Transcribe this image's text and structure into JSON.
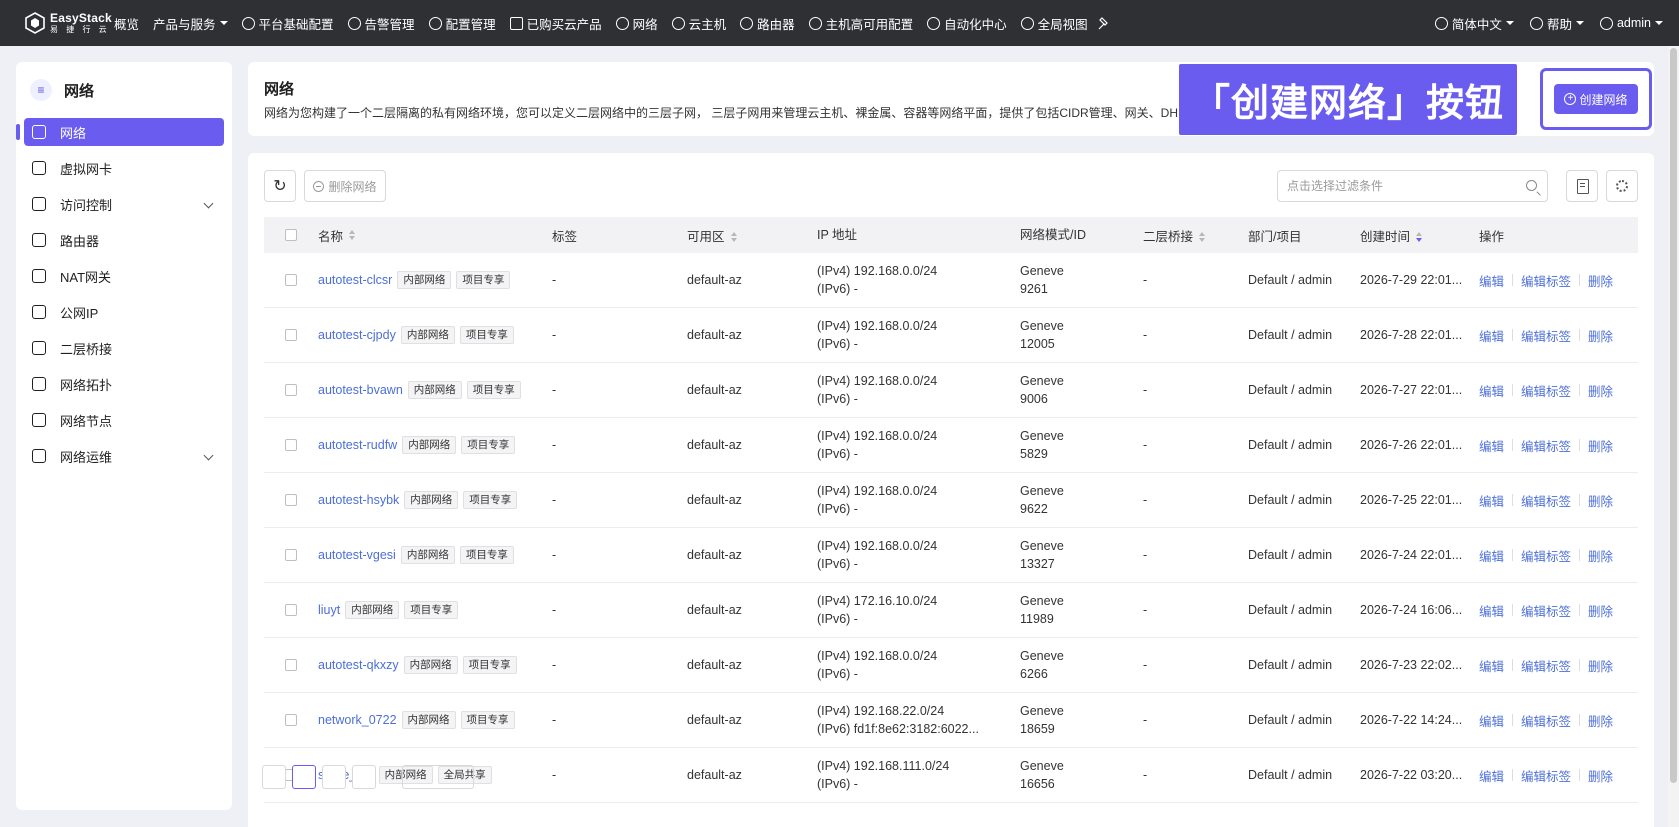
{
  "brand": {
    "name_en": "EasyStack",
    "name_cn": "易 捷 行 云"
  },
  "topnav": {
    "items": [
      {
        "label": "概览",
        "icon": "",
        "caret": false
      },
      {
        "label": "产品与服务",
        "icon": "",
        "caret": true
      },
      {
        "label": "平台基础配置",
        "icon": "gear-icon",
        "caret": false
      },
      {
        "label": "告警管理",
        "icon": "bell-icon",
        "caret": false
      },
      {
        "label": "配置管理",
        "icon": "settings-icon",
        "caret": false
      },
      {
        "label": "已购买云产品",
        "icon": "list-icon",
        "caret": false
      },
      {
        "label": "网络",
        "icon": "network-icon",
        "caret": false
      },
      {
        "label": "云主机",
        "icon": "cloud-icon",
        "caret": false
      },
      {
        "label": "路由器",
        "icon": "router-icon",
        "caret": false
      },
      {
        "label": "主机高可用配置",
        "icon": "host-ha-icon",
        "caret": false
      },
      {
        "label": "自动化中心",
        "icon": "automation-icon",
        "caret": false
      },
      {
        "label": "全局视图",
        "icon": "global-view-icon",
        "caret": false
      }
    ],
    "right": {
      "language": "简体中文",
      "help": "帮助",
      "user": "admin"
    }
  },
  "sidebar": {
    "title": "网络",
    "items": [
      {
        "label": "网络",
        "icon": "network-icon",
        "active": true,
        "expandable": false
      },
      {
        "label": "虚拟网卡",
        "icon": "nic-icon",
        "active": false,
        "expandable": false
      },
      {
        "label": "访问控制",
        "icon": "access-control-icon",
        "active": false,
        "expandable": true
      },
      {
        "label": "路由器",
        "icon": "router-icon",
        "active": false,
        "expandable": false
      },
      {
        "label": "NAT网关",
        "icon": "nat-gateway-icon",
        "active": false,
        "expandable": false
      },
      {
        "label": "公网IP",
        "icon": "public-ip-icon",
        "active": false,
        "expandable": false
      },
      {
        "label": "二层桥接",
        "icon": "bridge-icon",
        "active": false,
        "expandable": false
      },
      {
        "label": "网络拓扑",
        "icon": "topology-icon",
        "active": false,
        "expandable": false
      },
      {
        "label": "网络节点",
        "icon": "node-icon",
        "active": false,
        "expandable": false
      },
      {
        "label": "网络运维",
        "icon": "ops-icon",
        "active": false,
        "expandable": true
      }
    ]
  },
  "header": {
    "title": "网络",
    "description": "网络为您构建了一个二层隔离的私有网络环境，您可以定义二层网络中的三层子网， 三层子网用来管理云主机、裸金属、容器等网络平面，提供了包括CIDR管理、网关、DH",
    "create_button": "创建网络",
    "annotation": "「创建网络」按钮"
  },
  "toolbar": {
    "delete_label": "删除网络",
    "search_placeholder": "点击选择过滤条件"
  },
  "table": {
    "columns": [
      "名称",
      "标签",
      "可用区",
      "IP 地址",
      "网络模式/ID",
      "二层桥接",
      "部门/项目",
      "创建时间",
      "操作"
    ],
    "ops": [
      "编辑",
      "编辑标签",
      "删除"
    ],
    "rows": [
      {
        "name": "autotest-clcsr",
        "badges": [
          "内部网络",
          "项目专享"
        ],
        "tag": "-",
        "az": "default-az",
        "ipv4": "(IPv4) 192.168.0.0/24",
        "ipv6": "(IPv6) -",
        "mode": "Geneve",
        "id": "9261",
        "bridge": "-",
        "dept": "Default / admin",
        "time": "2026-7-29 22:01..."
      },
      {
        "name": "autotest-cjpdy",
        "badges": [
          "内部网络",
          "项目专享"
        ],
        "tag": "-",
        "az": "default-az",
        "ipv4": "(IPv4) 192.168.0.0/24",
        "ipv6": "(IPv6) -",
        "mode": "Geneve",
        "id": "12005",
        "bridge": "-",
        "dept": "Default / admin",
        "time": "2026-7-28 22:01..."
      },
      {
        "name": "autotest-bvawn",
        "badges": [
          "内部网络",
          "项目专享"
        ],
        "tag": "-",
        "az": "default-az",
        "ipv4": "(IPv4) 192.168.0.0/24",
        "ipv6": "(IPv6) -",
        "mode": "Geneve",
        "id": "9006",
        "bridge": "-",
        "dept": "Default / admin",
        "time": "2026-7-27 22:01..."
      },
      {
        "name": "autotest-rudfw",
        "badges": [
          "内部网络",
          "项目专享"
        ],
        "tag": "-",
        "az": "default-az",
        "ipv4": "(IPv4) 192.168.0.0/24",
        "ipv6": "(IPv6) -",
        "mode": "Geneve",
        "id": "5829",
        "bridge": "-",
        "dept": "Default / admin",
        "time": "2026-7-26 22:01..."
      },
      {
        "name": "autotest-hsybk",
        "badges": [
          "内部网络",
          "项目专享"
        ],
        "tag": "-",
        "az": "default-az",
        "ipv4": "(IPv4) 192.168.0.0/24",
        "ipv6": "(IPv6) -",
        "mode": "Geneve",
        "id": "9622",
        "bridge": "-",
        "dept": "Default / admin",
        "time": "2026-7-25 22:01..."
      },
      {
        "name": "autotest-vgesi",
        "badges": [
          "内部网络",
          "项目专享"
        ],
        "tag": "-",
        "az": "default-az",
        "ipv4": "(IPv4) 192.168.0.0/24",
        "ipv6": "(IPv6) -",
        "mode": "Geneve",
        "id": "13327",
        "bridge": "-",
        "dept": "Default / admin",
        "time": "2026-7-24 22:01..."
      },
      {
        "name": "liuyt",
        "badges": [
          "内部网络",
          "项目专享"
        ],
        "tag": "-",
        "az": "default-az",
        "ipv4": "(IPv4) 172.16.10.0/24",
        "ipv6": "(IPv6) -",
        "mode": "Geneve",
        "id": "11989",
        "bridge": "-",
        "dept": "Default / admin",
        "time": "2026-7-24 16:06..."
      },
      {
        "name": "autotest-qkxzy",
        "badges": [
          "内部网络",
          "项目专享"
        ],
        "tag": "-",
        "az": "default-az",
        "ipv4": "(IPv4) 192.168.0.0/24",
        "ipv6": "(IPv6) -",
        "mode": "Geneve",
        "id": "6266",
        "bridge": "-",
        "dept": "Default / admin",
        "time": "2026-7-23 22:02..."
      },
      {
        "name": "network_0722",
        "badges": [
          "内部网络",
          "项目专享"
        ],
        "tag": "-",
        "az": "default-az",
        "ipv4": "(IPv4) 192.168.22.0/24",
        "ipv6": "(IPv6) fd1f:8e62:3182:6022...",
        "mode": "Geneve",
        "id": "18659",
        "bridge": "-",
        "dept": "Default / admin",
        "time": "2026-7-22 14:24..."
      },
      {
        "name": "share_net",
        "badges": [
          "内部网络",
          "全局共享"
        ],
        "tag": "-",
        "az": "default-az",
        "ipv4": "(IPv4) 192.168.111.0/24",
        "ipv6": "(IPv6) -",
        "mode": "Geneve",
        "id": "16656",
        "bridge": "-",
        "dept": "Default / admin",
        "time": "2026-7-22 03:20..."
      }
    ]
  },
  "colors": {
    "accent": "#6b5cf0",
    "link": "#4c6fd8",
    "topbar": "#2f3034"
  }
}
